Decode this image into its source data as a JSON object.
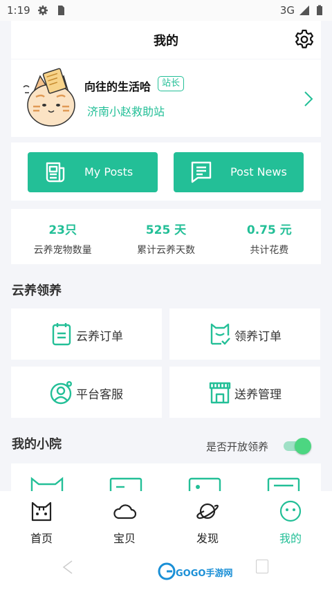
{
  "status_bar": {
    "time": "1:19",
    "network": "3G"
  },
  "header": {
    "title": "我的"
  },
  "profile": {
    "name": "向往的生活哈",
    "badge": "站长",
    "station": "济南小赵救助站"
  },
  "actions": {
    "my_posts": "My Posts",
    "post_news": "Post News"
  },
  "stats": [
    {
      "value": "23只",
      "label": "云养宠物数量"
    },
    {
      "value": "525 天",
      "label": "累计云养天数"
    },
    {
      "value": "0.75 元",
      "label": "共计花费"
    }
  ],
  "adopt_section": {
    "title": "云养领养",
    "tiles": [
      {
        "label": "云养订单",
        "icon": "clipboard-icon"
      },
      {
        "label": "领养订单",
        "icon": "adopt-order-icon"
      },
      {
        "label": "平台客服",
        "icon": "customer-service-icon"
      },
      {
        "label": "送养管理",
        "icon": "shop-icon"
      }
    ]
  },
  "yard_section": {
    "title": "我的小院",
    "toggle_label": "是否开放领养",
    "toggle_on": true
  },
  "tabs": [
    {
      "label": "首页",
      "icon": "cat-face-icon",
      "active": false
    },
    {
      "label": "宝贝",
      "icon": "cloud-icon",
      "active": false
    },
    {
      "label": "发现",
      "icon": "planet-icon",
      "active": false
    },
    {
      "label": "我的",
      "icon": "smiley-icon",
      "active": true
    }
  ],
  "watermark": "GOGO手游网",
  "colors": {
    "accent": "#23bf97",
    "toggle": "#4cd681",
    "page_bg": "#f4f5f9"
  }
}
